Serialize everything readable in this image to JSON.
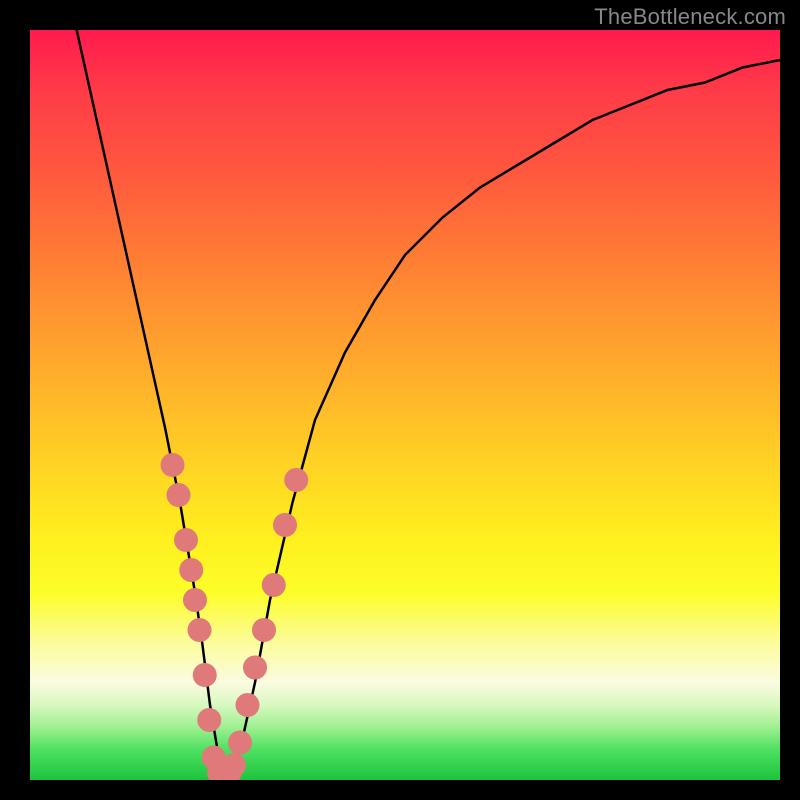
{
  "watermark": "TheBottleneck.com",
  "chart_data": {
    "type": "line",
    "title": "",
    "xlabel": "",
    "ylabel": "",
    "xlim": [
      0,
      100
    ],
    "ylim": [
      0,
      100
    ],
    "series": [
      {
        "name": "curve",
        "x": [
          6,
          8,
          10,
          12,
          14,
          16,
          18,
          20,
          22,
          23,
          24,
          25,
          26,
          27,
          28,
          30,
          32,
          35,
          38,
          42,
          46,
          50,
          55,
          60,
          65,
          70,
          75,
          80,
          85,
          90,
          95,
          100
        ],
        "y": [
          101,
          92,
          83,
          74,
          65,
          56,
          47,
          37,
          25,
          18,
          10,
          4,
          1,
          1,
          4,
          13,
          24,
          37,
          48,
          57,
          64,
          70,
          75,
          79,
          82,
          85,
          88,
          90,
          92,
          93,
          95,
          96
        ]
      }
    ],
    "dots": [
      {
        "x": 19.0,
        "y": 42
      },
      {
        "x": 19.8,
        "y": 38
      },
      {
        "x": 20.8,
        "y": 32
      },
      {
        "x": 21.5,
        "y": 28
      },
      {
        "x": 22.0,
        "y": 24
      },
      {
        "x": 22.6,
        "y": 20
      },
      {
        "x": 23.3,
        "y": 14
      },
      {
        "x": 23.9,
        "y": 8
      },
      {
        "x": 24.5,
        "y": 3
      },
      {
        "x": 25.2,
        "y": 1
      },
      {
        "x": 26.0,
        "y": 1
      },
      {
        "x": 26.6,
        "y": 1
      },
      {
        "x": 27.2,
        "y": 2
      },
      {
        "x": 28.0,
        "y": 5
      },
      {
        "x": 29.0,
        "y": 10
      },
      {
        "x": 30.0,
        "y": 15
      },
      {
        "x": 31.2,
        "y": 20
      },
      {
        "x": 32.5,
        "y": 26
      },
      {
        "x": 34.0,
        "y": 34
      },
      {
        "x": 35.5,
        "y": 40
      }
    ],
    "dot_color": "#e07a7a",
    "dot_radius": 12,
    "curve_color": "#000000",
    "curve_width": 2.5
  }
}
